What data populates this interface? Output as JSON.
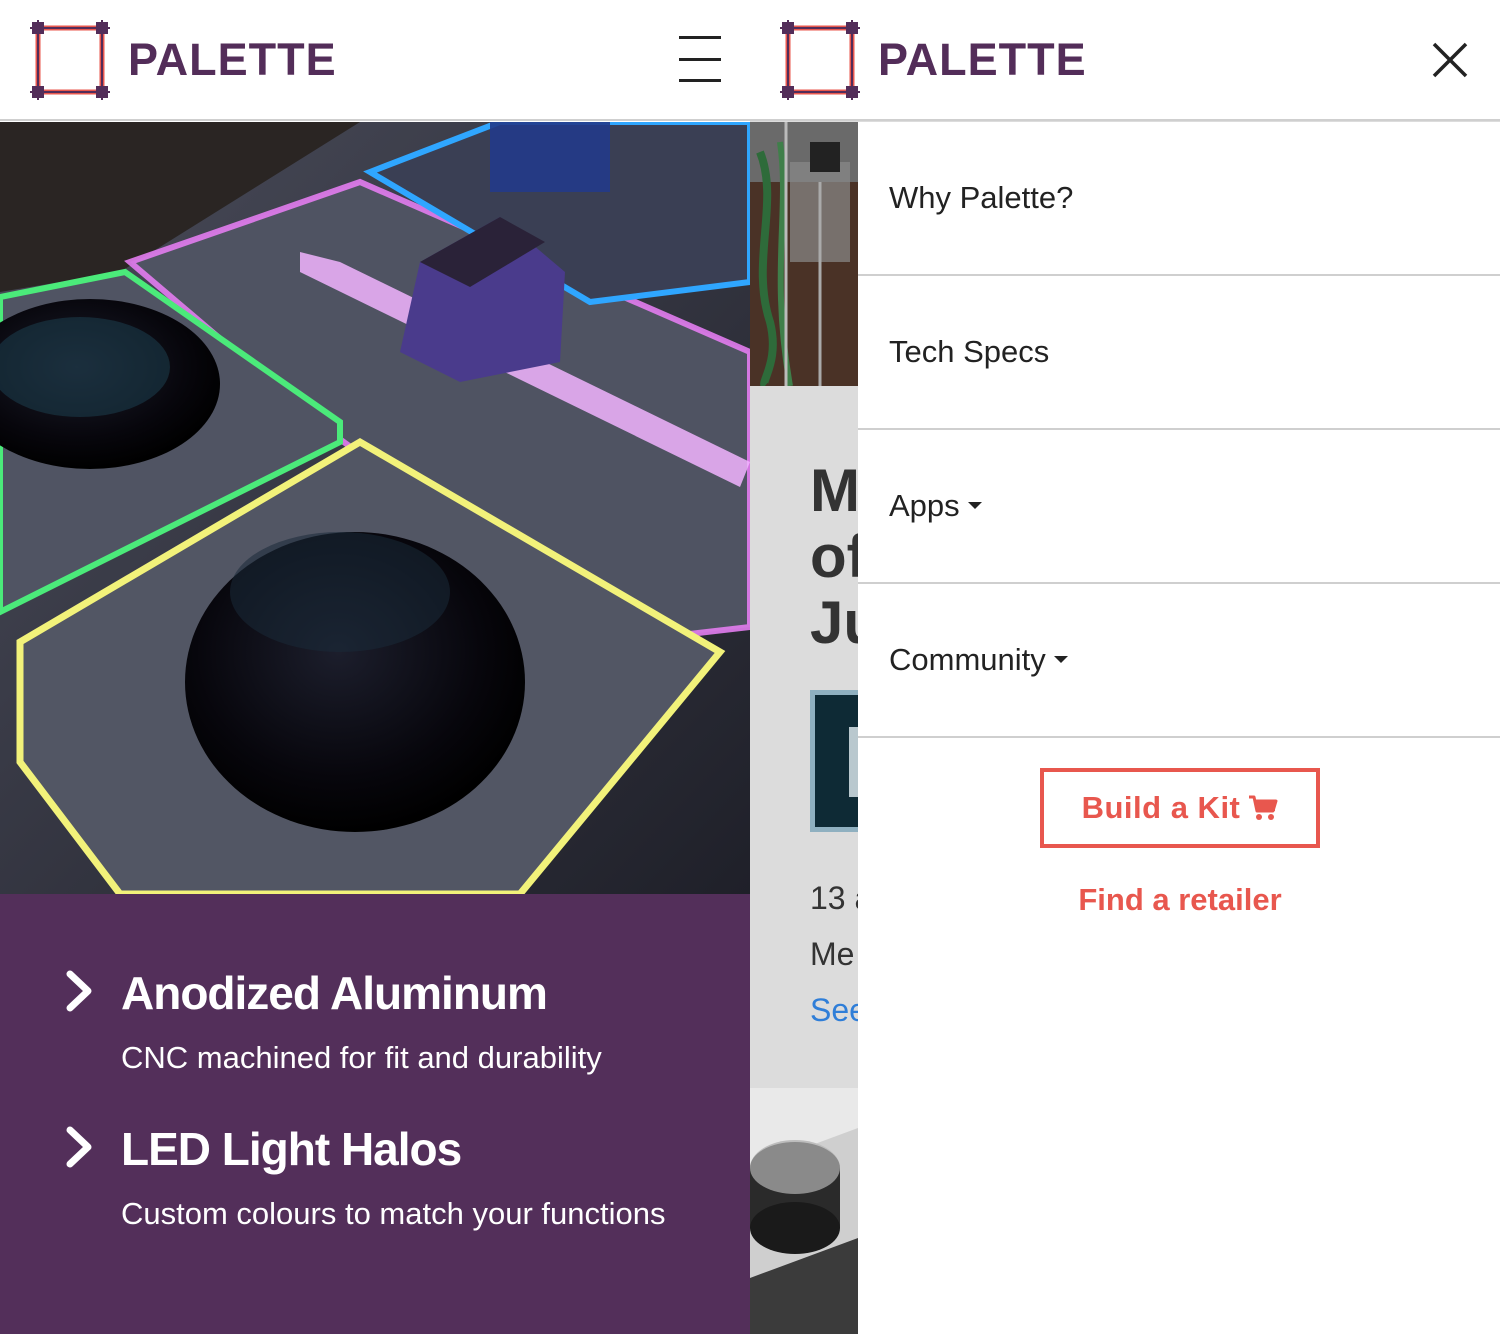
{
  "brand": {
    "name": "PALETTE",
    "text_color": "#532d59",
    "mark_color": "#e8574e",
    "corner_color": "#532d59"
  },
  "left_panel": {
    "menu_icon": "hamburger-icon",
    "features_bg": "#532f5a",
    "features": [
      {
        "icon": "chevron-right-icon",
        "title": "Anodized Aluminum",
        "description": "CNC machined for fit and durability"
      },
      {
        "icon": "chevron-right-icon",
        "title": "LED Light Halos",
        "description": "Custom colours to match your functions"
      }
    ]
  },
  "right_panel": {
    "close_icon": "close-icon",
    "background_page": {
      "heading_lines": [
        "M",
        "of",
        "Ju"
      ],
      "text_lines": [
        "13 a",
        "Me"
      ],
      "link_text": "See"
    },
    "menu": {
      "items": [
        {
          "label": "Why Palette?",
          "dropdown": false
        },
        {
          "label": "Tech Specs",
          "dropdown": false
        },
        {
          "label": "Apps",
          "dropdown": true
        },
        {
          "label": "Community",
          "dropdown": true
        }
      ],
      "cta_label": "Build a Kit",
      "cta_icon": "cart-icon",
      "retailer_link": "Find a retailer",
      "accent_color": "#e8574e"
    }
  }
}
